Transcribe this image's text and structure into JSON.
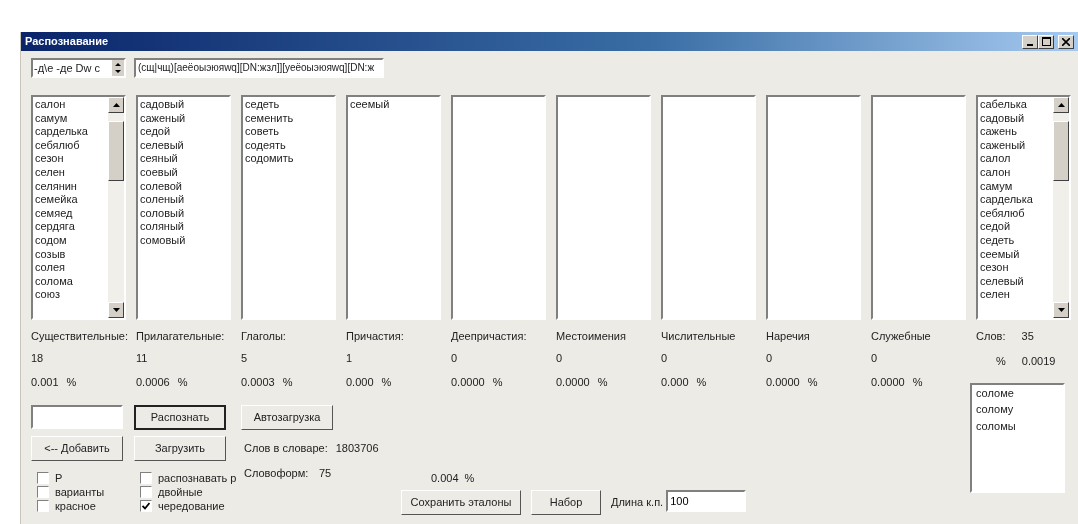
{
  "window": {
    "title": "Распознавание"
  },
  "pattern_spinner": {
    "value": "-д\\е -де Dw c"
  },
  "pattern_field": {
    "value": "(сщ|чщ)[аеёоыэюяwq][DN:жзл]][уеёоыэюяwq][DN:ж"
  },
  "categories": [
    {
      "label": "Существительные:",
      "count": "18",
      "percent": "0.001",
      "unit": "%",
      "scrollbar": true,
      "items": [
        "салон",
        "самум",
        "сарделька",
        "себялюб",
        "сезон",
        "селен",
        "селянин",
        "семейка",
        "семяед",
        "сердяга",
        "содом",
        "созыв",
        "солея",
        "солома",
        "союз"
      ]
    },
    {
      "label": "Прилагательные:",
      "count": "11",
      "percent": "0.0006",
      "unit": "%",
      "scrollbar": false,
      "items": [
        "садовый",
        "саженый",
        "седой",
        "селевый",
        "сеяный",
        "соевый",
        "солевой",
        "соленый",
        "соловый",
        "соляный",
        "сомовый"
      ]
    },
    {
      "label": "Глаголы:",
      "count": "5",
      "percent": "0.0003",
      "unit": "%",
      "scrollbar": false,
      "items": [
        "седеть",
        "семенить",
        "советь",
        "содеять",
        "содомить"
      ]
    },
    {
      "label": "Причастия:",
      "count": "1",
      "percent": "0.000",
      "unit": "%",
      "scrollbar": false,
      "items": [
        "сеемый"
      ]
    },
    {
      "label": "Деепричастия:",
      "count": "0",
      "percent": "0.0000",
      "unit": "%",
      "scrollbar": false
    },
    {
      "label": "Местоимения",
      "count": "0",
      "percent": "0.0000",
      "unit": "%",
      "scrollbar": false
    },
    {
      "label": "Числительные",
      "count": "0",
      "percent": "0.000",
      "unit": "%",
      "scrollbar": false
    },
    {
      "label": "Наречия",
      "count": "0",
      "percent": "0.0000",
      "unit": "%",
      "scrollbar": false
    },
    {
      "label": "Служебные",
      "count": "0",
      "percent": "0.0000",
      "unit": "%",
      "scrollbar": false
    }
  ],
  "all_words": {
    "label": "Слов:",
    "count": "35",
    "unit": "%",
    "percent": "0.0019",
    "scrollbar": true,
    "items": [
      "сабелька",
      "садовый",
      "сажень",
      "саженый",
      "салол",
      "салон",
      "самум",
      "сарделька",
      "себялюб",
      "седой",
      "седеть",
      "сеемый",
      "сезон",
      "селевый",
      "селен"
    ]
  },
  "buttons_row1": [
    {
      "label": "Распознать",
      "default": true
    },
    {
      "label": "Автозагрузка",
      "default": false
    }
  ],
  "buttons_row2": [
    {
      "label": "<-- Добавить",
      "default": false
    },
    {
      "label": "Загрузить",
      "default": false
    }
  ],
  "dictionary": {
    "label": "Слов в словаре:",
    "value": "1803706"
  },
  "wordforms": {
    "label": "Словоформ:",
    "value": "75",
    "percent": "0.004",
    "unit": "%"
  },
  "checkboxes_left": [
    {
      "label": "Р",
      "checked": false
    },
    {
      "label": "варианты",
      "checked": false
    },
    {
      "label": "красное",
      "checked": false
    }
  ],
  "checkboxes_right": [
    {
      "label": "распознавать р",
      "checked": false
    },
    {
      "label": "двойные",
      "checked": false
    },
    {
      "label": "чередование",
      "checked": true
    }
  ],
  "buttons_row3": [
    {
      "label": "Сохранить эталоны",
      "default": false
    },
    {
      "label": "Набор",
      "default": false
    }
  ],
  "chain_length": {
    "label": "Длина к.п.",
    "value": "100"
  },
  "forms_list": {
    "items": [
      "соломе",
      "солому",
      "соломы"
    ]
  }
}
